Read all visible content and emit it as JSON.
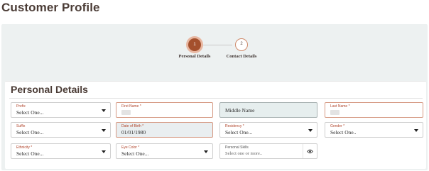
{
  "page_title": "Customer Profile",
  "stepper": {
    "steps": [
      {
        "number": "1",
        "label": "Personal Details",
        "state": "active"
      },
      {
        "number": "2",
        "label": "Contact Details",
        "state": "inactive"
      }
    ]
  },
  "section_title": "Personal Details",
  "fields": {
    "prefix": {
      "label": "Prefix",
      "value": "Select One..."
    },
    "first_name": {
      "label": "First Name *",
      "value": ""
    },
    "middle_name": {
      "label": "",
      "value": "Middle Name"
    },
    "last_name": {
      "label": "Last Name *",
      "value": ""
    },
    "suffix": {
      "label": "Suffix",
      "value": "Select One..."
    },
    "dob": {
      "label": "Date of Birth *",
      "value": "01/01/1980"
    },
    "residency": {
      "label": "Residency *",
      "value": "Select One..."
    },
    "gender": {
      "label": "Gender *",
      "value": "Select One.."
    },
    "ethnicity": {
      "label": "Ethnicity *",
      "value": "Select One..."
    },
    "eye_color": {
      "label": "Eye Color *",
      "value": "Select One..."
    },
    "personal_skills": {
      "label": "Personal Skills",
      "placeholder": "Select one or more.."
    }
  },
  "colors": {
    "accent": "#a4502d",
    "required_label": "#b1452b",
    "panel_bg": "#edf1f1"
  },
  "icons": {
    "dropdown": "caret-down-icon",
    "view": "eye-icon"
  }
}
